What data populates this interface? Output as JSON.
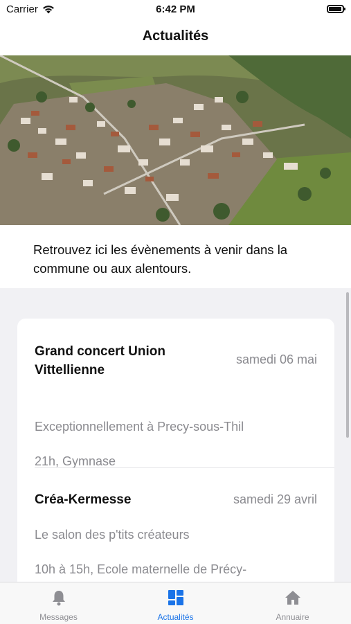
{
  "status_bar": {
    "carrier": "Carrier",
    "time": "6:42 PM"
  },
  "header": {
    "title": "Actualités"
  },
  "intro": {
    "text": "Retrouvez ici les évènements à venir dans la commune ou aux alentours."
  },
  "events": [
    {
      "title": "Grand concert Union Vittellienne",
      "date": "samedi 06 mai",
      "description": "Exceptionnellement à Precy-sous-Thil",
      "details": "21h, Gymnase"
    },
    {
      "title": "Créa-Kermesse",
      "date": "samedi 29 avril",
      "description": "Le salon des p'tits créateurs",
      "details": "10h à 15h, Ecole maternelle de Précy-"
    }
  ],
  "tab_bar": {
    "tabs": [
      {
        "label": "Messages",
        "icon": "bell-icon",
        "active": false
      },
      {
        "label": "Actualités",
        "icon": "grid-icon",
        "active": true
      },
      {
        "label": "Annuaire",
        "icon": "house-icon",
        "active": false
      }
    ]
  },
  "colors": {
    "accent": "#1a73e8",
    "secondary_text": "#8b8b90",
    "background": "#f1f1f4"
  }
}
